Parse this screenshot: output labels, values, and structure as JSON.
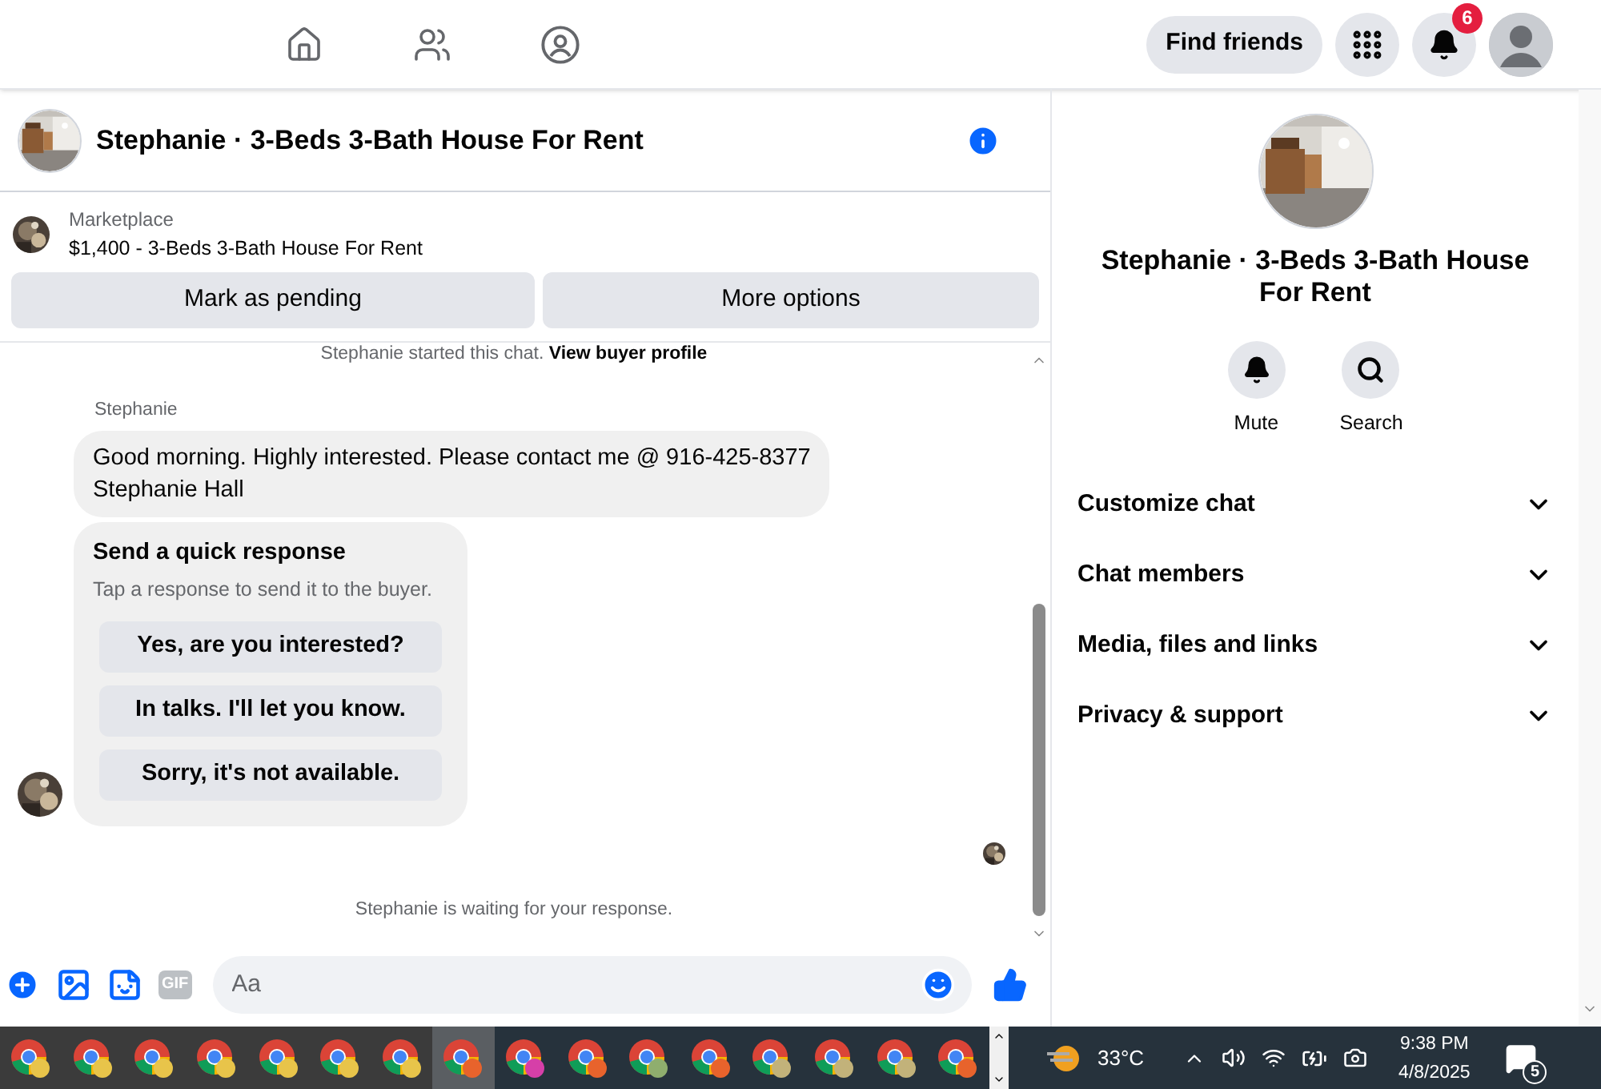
{
  "top_nav": {
    "tabs": [
      {
        "kind": "home",
        "selected": false
      },
      {
        "kind": "friends",
        "selected": false
      },
      {
        "kind": "groups",
        "selected": false
      }
    ],
    "find_friends": "Find friends",
    "notification_count": "6"
  },
  "chat": {
    "title": "Stephanie · 3-Beds 3-Bath House For Rent",
    "listing": {
      "source": "Marketplace",
      "text": "$1,400 - 3-Beds 3-Bath House For Rent"
    },
    "actions": [
      "Mark as pending",
      "More options"
    ],
    "started": {
      "text": "Stephanie started this chat.",
      "link": "View buyer profile"
    },
    "sender": "Stephanie",
    "message": [
      "Good morning. Highly interested. Please contact me @ 916-425-8377",
      "Stephanie Hall"
    ],
    "quick_response": {
      "title": "Send a quick response",
      "subtitle": "Tap a response to send it to the buyer.",
      "options": [
        "Yes, are you interested?",
        "In talks. I'll let you know.",
        "Sorry, it's not available."
      ]
    },
    "waiting": "Stephanie is waiting for your response.",
    "composer": {
      "placeholder": "Aa",
      "gif": "GIF"
    }
  },
  "details": {
    "title": "Stephanie · 3-Beds 3-Bath House For Rent",
    "actions": [
      {
        "kind": "mute",
        "label": "Mute"
      },
      {
        "kind": "search",
        "label": "Search"
      }
    ],
    "sections": [
      {
        "label": "Customize chat",
        "expanded": false
      },
      {
        "label": "Chat members",
        "expanded": false
      },
      {
        "label": "Media, files and links",
        "expanded": false
      },
      {
        "label": "Privacy & support",
        "expanded": false
      }
    ]
  },
  "taskbar": {
    "apps": [
      {
        "color": "#e8c44a",
        "selected": false
      },
      {
        "color": "#e8c44a",
        "selected": false
      },
      {
        "color": "#e8c44a",
        "selected": false
      },
      {
        "color": "#e8c44a",
        "selected": false
      },
      {
        "color": "#e8c44a",
        "selected": false
      },
      {
        "color": "#e8c44a",
        "selected": false
      },
      {
        "color": "#e8c44a",
        "selected": false
      },
      {
        "color": "#e8632c",
        "selected": true
      },
      {
        "color": "#d63fa8",
        "selected": false
      },
      {
        "color": "#e8632c",
        "selected": false
      },
      {
        "color": "#8fae6e",
        "selected": false
      },
      {
        "color": "#e8632c",
        "selected": false
      },
      {
        "color": "#c2b27a",
        "selected": false
      },
      {
        "color": "#c2b27a",
        "selected": false
      },
      {
        "color": "#c2b27a",
        "selected": false
      },
      {
        "color": "#e8632c",
        "selected": false
      }
    ],
    "temperature": "33°C",
    "time": "9:38 PM",
    "date": "4/8/2025",
    "notifications": "5"
  }
}
